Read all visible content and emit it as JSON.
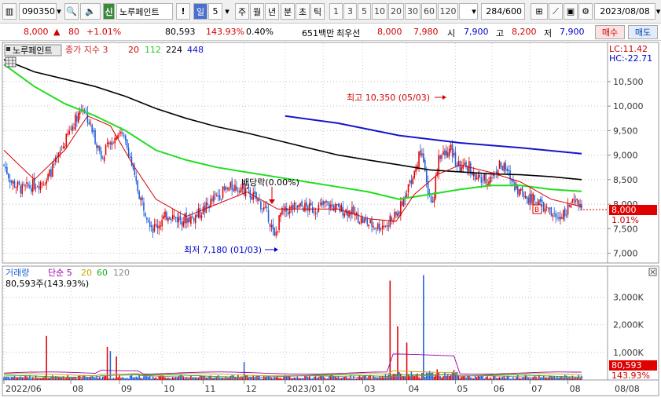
{
  "toolbar": {
    "code": "090350",
    "badge": "신",
    "name": "노루페인트",
    "warn": "!",
    "period_label": "일",
    "period_value": "5",
    "periods": [
      "주",
      "월",
      "년",
      "분",
      "초",
      "틱"
    ],
    "minutes": [
      "1",
      "3",
      "5",
      "10",
      "20",
      "30",
      "60",
      "120"
    ],
    "count": "284",
    "count_total": "/600",
    "date": "2023/08/08"
  },
  "quote": {
    "price": "8,000",
    "change": "80",
    "change_pct": "+1.01%",
    "volume": "80,593",
    "volume_pct": "143.93%",
    "turnover_pct": "0.40%",
    "amount": "651백만",
    "best_label": "최우선",
    "best_ask": "8,000",
    "best_bid": "7,980",
    "open_label": "시",
    "open": "7,900",
    "high_label": "고",
    "high": "8,200",
    "low_label": "저",
    "low": "7,900",
    "buy_label": "매수",
    "sell_label": "매도"
  },
  "price_panel": {
    "tab": "노루페인트",
    "ma_title": "종가 지수 3",
    "ma_values": [
      "20",
      "112",
      "224",
      "448"
    ],
    "lc": "LC:11.42",
    "hc": "HC:-22.71",
    "high_note": "최고 10,350 (05/03)",
    "low_note": "최저 7,180 (01/03)",
    "dividend_note": "배당락(0.00%)",
    "b_marker": "B",
    "current_price": "8,000",
    "current_pct": "1.01%"
  },
  "volume_panel": {
    "title": "거래량",
    "ma_label": "단순 5",
    "ma_values": [
      "20",
      "60",
      "120"
    ],
    "summary": "80,593주(143.93%)",
    "current_volume": "80,593",
    "current_pct": "143.93%"
  },
  "x_axis": {
    "labels": [
      "2022/06",
      "08",
      "09",
      "10",
      "11",
      "12",
      "2023/01",
      "02",
      "03",
      "04",
      "05",
      "06",
      "07",
      "08",
      "08/08"
    ]
  },
  "chart_data": {
    "type": "candlestick",
    "y_ticks": [
      7000,
      7500,
      8000,
      8500,
      9000,
      9500,
      10000,
      10500
    ],
    "y_tick_labels": [
      "7,000",
      "7,500",
      "8,000",
      "8,500",
      "9,000",
      "9,500",
      "10,000",
      "10,500"
    ],
    "ylim": [
      6800,
      11300
    ],
    "volume_ticks": [
      1000,
      2000,
      3000
    ],
    "volume_tick_labels": [
      "1,000K",
      "2,000K",
      "3,000K"
    ],
    "volume_ylim": [
      0,
      3900
    ],
    "x_index_range": [
      0,
      284
    ],
    "month_index": [
      0,
      44,
      76,
      104,
      131,
      158,
      185,
      210,
      236,
      265,
      297,
      321,
      346,
      371
    ],
    "close_path": [
      [
        0,
        8800
      ],
      [
        5,
        8450
      ],
      [
        12,
        8300
      ],
      [
        20,
        8400
      ],
      [
        28,
        8500
      ],
      [
        35,
        8900
      ],
      [
        42,
        9400
      ],
      [
        48,
        9800
      ],
      [
        52,
        10000
      ],
      [
        58,
        9500
      ],
      [
        64,
        9000
      ],
      [
        70,
        9200
      ],
      [
        76,
        9500
      ],
      [
        82,
        9100
      ],
      [
        86,
        8500
      ],
      [
        90,
        8100
      ],
      [
        94,
        7800
      ],
      [
        98,
        7500
      ],
      [
        102,
        7600
      ],
      [
        108,
        7800
      ],
      [
        114,
        7700
      ],
      [
        120,
        7700
      ],
      [
        126,
        7750
      ],
      [
        132,
        7900
      ],
      [
        138,
        8100
      ],
      [
        144,
        8250
      ],
      [
        150,
        8350
      ],
      [
        156,
        8350
      ],
      [
        162,
        8200
      ],
      [
        168,
        8050
      ],
      [
        174,
        7750
      ],
      [
        178,
        7300
      ],
      [
        182,
        7800
      ],
      [
        188,
        7900
      ],
      [
        196,
        7950
      ],
      [
        204,
        7900
      ],
      [
        212,
        8000
      ],
      [
        220,
        7900
      ],
      [
        228,
        7850
      ],
      [
        234,
        7700
      ],
      [
        240,
        7600
      ],
      [
        246,
        7550
      ],
      [
        252,
        7600
      ],
      [
        258,
        7750
      ],
      [
        262,
        8000
      ],
      [
        266,
        8400
      ],
      [
        270,
        8600
      ],
      [
        274,
        9100
      ],
      [
        278,
        8400
      ],
      [
        282,
        8000
      ],
      [
        286,
        9000
      ],
      [
        290,
        9000
      ],
      [
        294,
        9100
      ],
      [
        298,
        8800
      ],
      [
        302,
        8700
      ],
      [
        306,
        8800
      ],
      [
        310,
        8500
      ],
      [
        314,
        8500
      ],
      [
        318,
        8500
      ],
      [
        322,
        8600
      ],
      [
        326,
        8800
      ],
      [
        330,
        8700
      ],
      [
        334,
        8500
      ],
      [
        338,
        8300
      ],
      [
        342,
        8200
      ],
      [
        346,
        8100
      ],
      [
        350,
        8100
      ],
      [
        356,
        7900
      ],
      [
        360,
        7800
      ],
      [
        364,
        7700
      ],
      [
        370,
        7900
      ],
      [
        374,
        8000
      ],
      [
        380,
        8000
      ]
    ],
    "big_volumes": [
      [
        28,
        1600
      ],
      [
        68,
        1200
      ],
      [
        70,
        1050
      ],
      [
        74,
        850
      ],
      [
        158,
        650
      ],
      [
        254,
        3600
      ],
      [
        259,
        1950
      ],
      [
        265,
        1350
      ],
      [
        276,
        3800
      ]
    ],
    "ma_lines": {
      "ma20": [
        [
          0,
          9100
        ],
        [
          20,
          8500
        ],
        [
          40,
          9100
        ],
        [
          55,
          9800
        ],
        [
          70,
          9600
        ],
        [
          85,
          8800
        ],
        [
          100,
          8100
        ],
        [
          120,
          7750
        ],
        [
          140,
          8000
        ],
        [
          160,
          8250
        ],
        [
          180,
          7900
        ],
        [
          200,
          7900
        ],
        [
          220,
          7900
        ],
        [
          240,
          7700
        ],
        [
          258,
          7650
        ],
        [
          270,
          8200
        ],
        [
          285,
          8600
        ],
        [
          300,
          8800
        ],
        [
          320,
          8650
        ],
        [
          340,
          8450
        ],
        [
          360,
          8100
        ],
        [
          380,
          7950
        ]
      ],
      "ma112": [
        [
          0,
          10850
        ],
        [
          20,
          10400
        ],
        [
          40,
          10050
        ],
        [
          60,
          9800
        ],
        [
          80,
          9500
        ],
        [
          100,
          9100
        ],
        [
          120,
          8900
        ],
        [
          140,
          8750
        ],
        [
          160,
          8650
        ],
        [
          180,
          8550
        ],
        [
          200,
          8450
        ],
        [
          220,
          8350
        ],
        [
          240,
          8250
        ],
        [
          260,
          8100
        ],
        [
          280,
          8200
        ],
        [
          300,
          8300
        ],
        [
          320,
          8380
        ],
        [
          340,
          8380
        ],
        [
          360,
          8300
        ],
        [
          380,
          8260
        ]
      ],
      "ma224": [
        [
          0,
          10950
        ],
        [
          20,
          10700
        ],
        [
          40,
          10550
        ],
        [
          60,
          10400
        ],
        [
          80,
          10200
        ],
        [
          100,
          9950
        ],
        [
          120,
          9750
        ],
        [
          140,
          9580
        ],
        [
          160,
          9450
        ],
        [
          180,
          9300
        ],
        [
          200,
          9150
        ],
        [
          220,
          9000
        ],
        [
          240,
          8900
        ],
        [
          260,
          8800
        ],
        [
          280,
          8700
        ],
        [
          300,
          8660
        ],
        [
          320,
          8620
        ],
        [
          340,
          8600
        ],
        [
          360,
          8560
        ],
        [
          380,
          8500
        ]
      ],
      "ma448": [
        [
          185,
          9800
        ],
        [
          220,
          9650
        ],
        [
          260,
          9400
        ],
        [
          300,
          9250
        ],
        [
          340,
          9150
        ],
        [
          380,
          9030
        ]
      ]
    },
    "colors": {
      "up": "#e00000",
      "down": "#1e5fd8",
      "ma20": "#d40000",
      "ma112": "#22dd22",
      "ma224": "#000000",
      "ma448": "#1515cc",
      "vol_ma5": "#9900aa",
      "vol_ma20": "#c8a400",
      "vol_ma60": "#22aa22",
      "vol_ma120": "#888888"
    }
  }
}
